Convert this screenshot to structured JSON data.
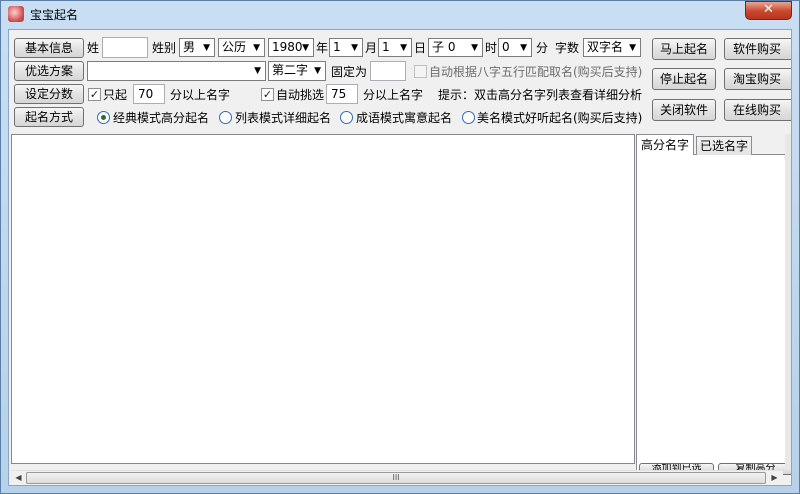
{
  "window": {
    "title": "宝宝起名",
    "close_glyph": "✕",
    "icon": "baby-app-icon"
  },
  "rows": {
    "basic_info_button": "基本信息",
    "surname_label": "姓",
    "surname_value": "",
    "gender_label": "姓别",
    "gender_value": "男",
    "calendar_value": "公历",
    "year_value": "1980",
    "year_label": "年",
    "month_value": "1",
    "month_label": "月",
    "day_value": "1",
    "day_label": "日",
    "hour_branch_value": "子 0",
    "hour_label": "时",
    "minute_value": "0",
    "minute_label": "分",
    "charcount_label": "字数",
    "charcount_value": "双字名",
    "preferred_plan_button": "优选方案",
    "plan_value": "",
    "second_char_value": "第二字",
    "fixed_as_label": "固定为",
    "fixed_value": "",
    "auto_bazi_label": "自动根据八字五行匹配取名(购买后支持)",
    "set_score_button": "设定分数",
    "only_label": "只起",
    "only_checked": true,
    "min_score_value": "70",
    "min_score_suffix": "分以上名字",
    "auto_pick_label": "自动挑选",
    "auto_pick_checked": true,
    "auto_pick_value": "75",
    "auto_pick_suffix": "分以上名字",
    "hint_text": "提示：双击高分名字列表查看详细分析",
    "naming_mode_button": "起名方式",
    "modes": [
      {
        "label": "经典模式高分起名",
        "selected": true
      },
      {
        "label": "列表模式详细起名",
        "selected": false
      },
      {
        "label": "成语模式寓意起名",
        "selected": false
      },
      {
        "label": "美名模式好听起名(购买后支持)",
        "selected": false
      }
    ]
  },
  "right_buttons": {
    "start": "马上起名",
    "buy": "软件购买",
    "stop": "停止起名",
    "taobao": "淘宝购买",
    "close": "关闭软件",
    "online": "在线购买"
  },
  "tabs": {
    "high_score": "高分名字",
    "selected": "已选名字"
  },
  "side_buttons": {
    "add": "添加到已选",
    "copy": "复制高分"
  },
  "scroll": {
    "left": "◀",
    "right": "▶",
    "grip": "III"
  },
  "colors": {
    "title_bar": "#bcd7ef",
    "close": "#c8462c"
  }
}
